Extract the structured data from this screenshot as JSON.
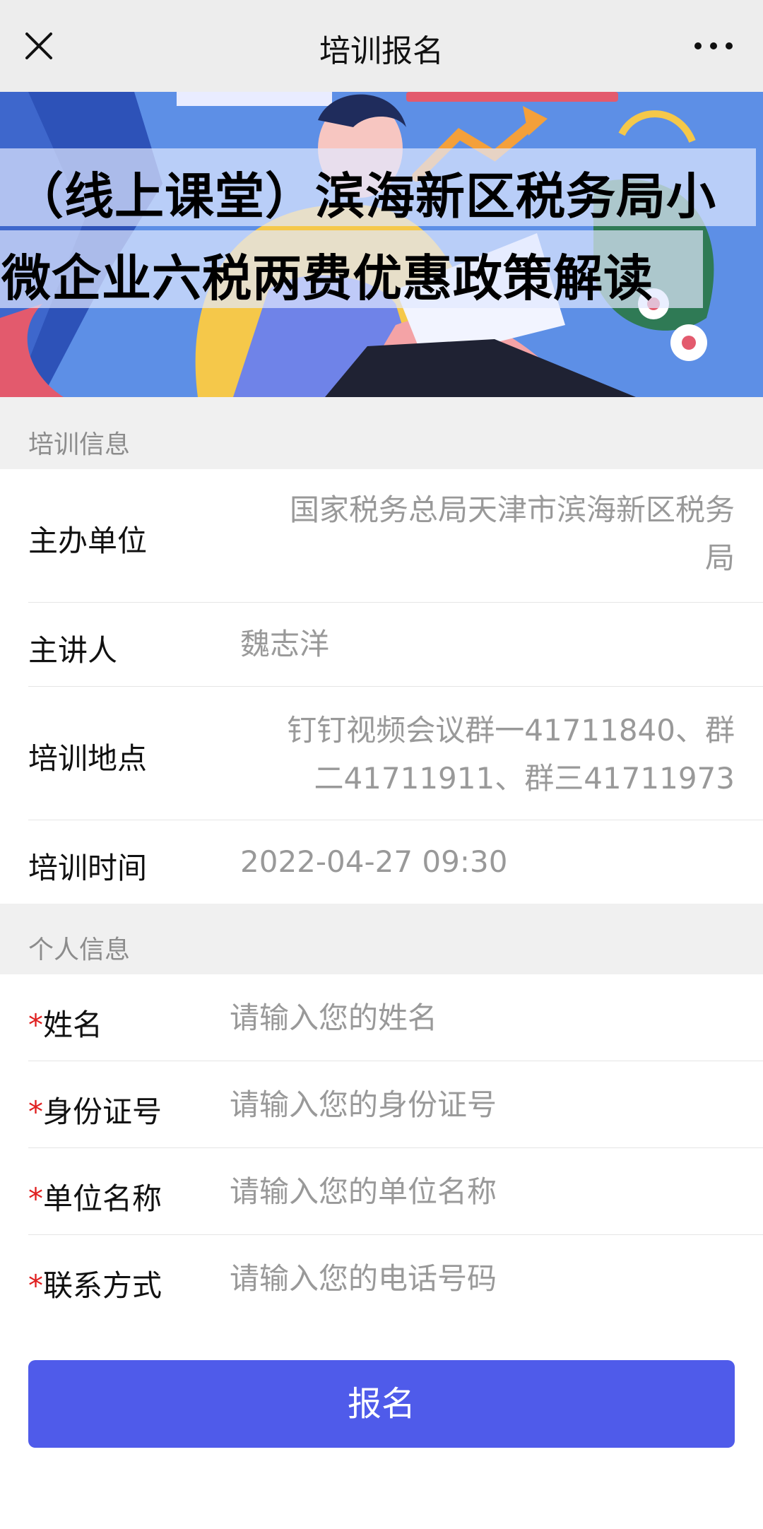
{
  "nav": {
    "title": "培训报名",
    "close_icon": "close-icon",
    "more_icon": "more-icon"
  },
  "banner": {
    "title_line1": "（线上课堂）滨海新区税务局小",
    "title_line2": "微企业六税两费优惠政策解读"
  },
  "training_info": {
    "section_title": "培训信息",
    "organizer_label": "主办单位",
    "organizer_line1": "国家税务总局天津市滨海新区税务",
    "organizer_line2": "局",
    "speaker_label": "主讲人",
    "speaker": "魏志洋",
    "location_label": "培训地点",
    "location_line1": "钉钉视频会议群一41711840、群",
    "location_line2": "二41711911、群三41711973",
    "time_label": "培训时间",
    "time": "2022-04-27 09:30"
  },
  "personal_info": {
    "section_title": "个人信息",
    "required_mark": "*",
    "name_label": "姓名",
    "name_placeholder": "请输入您的姓名",
    "id_label": "身份证号",
    "id_placeholder": "请输入您的身份证号",
    "company_label": "单位名称",
    "company_placeholder": "请输入您的单位名称",
    "contact_label": "联系方式",
    "contact_placeholder": "请输入您的电话号码"
  },
  "submit": {
    "label": "报名"
  },
  "colors": {
    "accent": "#4f5bea",
    "required": "#e02020",
    "section_bg": "#f0f0f0"
  }
}
